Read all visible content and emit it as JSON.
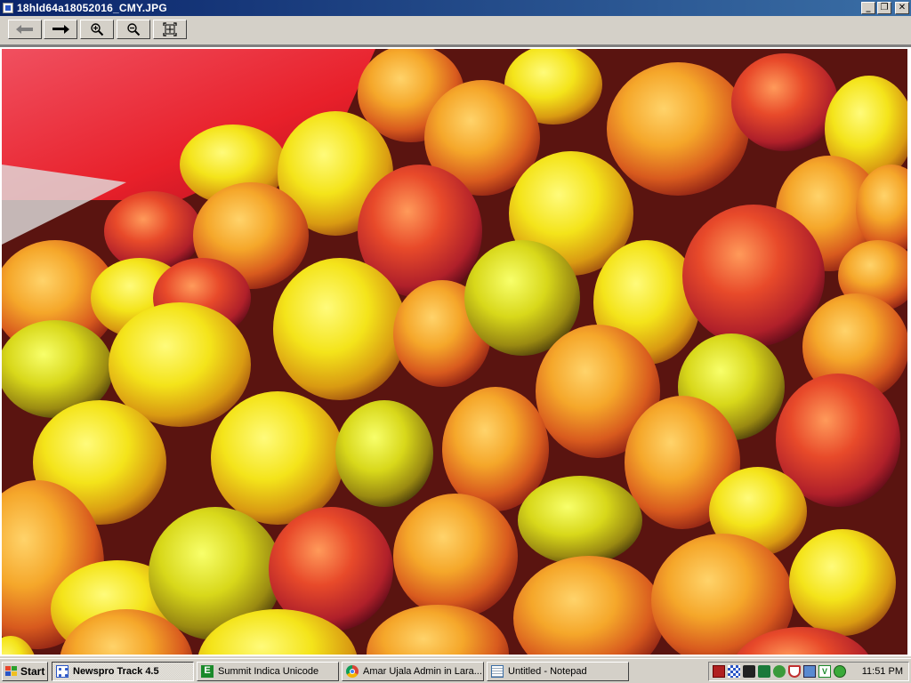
{
  "window": {
    "title": "18hld64a18052016_CMY.JPG",
    "minimize_glyph": "_",
    "restore_glyph": "❐",
    "close_glyph": "✕"
  },
  "toolbar": {
    "buttons": [
      {
        "name": "back",
        "icon": "arrow-left-icon"
      },
      {
        "name": "forward",
        "icon": "arrow-right-icon"
      },
      {
        "name": "zoom-in",
        "icon": "zoom-in-icon"
      },
      {
        "name": "zoom-out",
        "icon": "zoom-out-icon"
      },
      {
        "name": "fit",
        "icon": "fit-to-window-icon"
      }
    ]
  },
  "taskbar": {
    "start_label": "Start",
    "tasks": [
      {
        "label": "Newspro Track 4.5",
        "icon": "newspro-icon",
        "active": true
      },
      {
        "label": "Summit Indica Unicode",
        "icon": "summit-indica-icon",
        "active": false
      },
      {
        "label": "Amar Ujala Admin in Lara...",
        "icon": "chrome-icon",
        "active": false
      },
      {
        "label": "Untitled - Notepad",
        "icon": "notepad-icon",
        "active": false
      }
    ],
    "tray_icons": [
      "hindi-ime-icon",
      "network-icon",
      "keyboard-icon",
      "volume-icon",
      "security-icon",
      "shield-icon",
      "display-icon",
      "vc-icon",
      "update-icon"
    ],
    "clock": "11:51 PM"
  },
  "colors": {
    "title_start": "#0a246a",
    "title_end": "#3a6ea5",
    "chrome": "#d4d0c8"
  }
}
